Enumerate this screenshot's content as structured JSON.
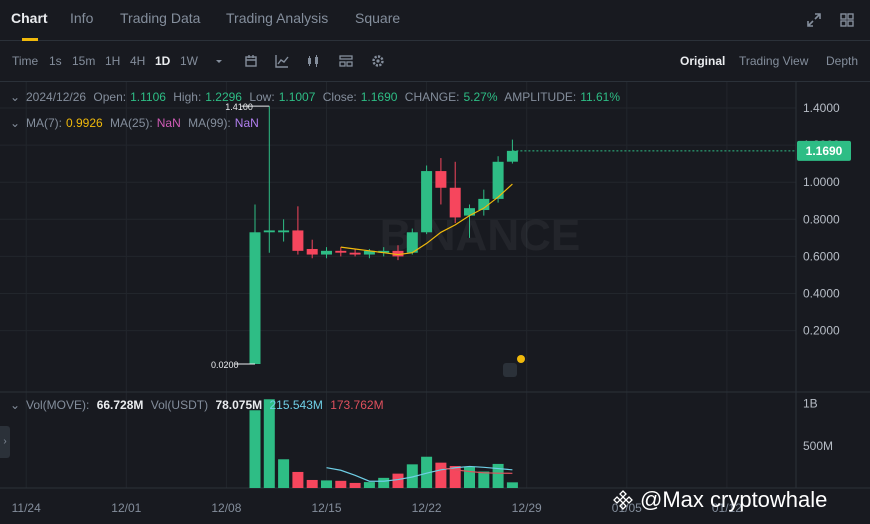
{
  "tabs": [
    "Chart",
    "Info",
    "Trading Data",
    "Trading Analysis",
    "Square"
  ],
  "window_icons": [
    "expand-icon",
    "grid-icon"
  ],
  "toolbar": {
    "time_label": "Time",
    "intervals": [
      "1s",
      "15m",
      "1H",
      "4H",
      "1D",
      "1W"
    ],
    "active_interval": "1D",
    "tool_icons": [
      "chevron-down-icon",
      "calendar-icon",
      "indicator-icon",
      "candle-type-icon",
      "template-icon",
      "gear-icon"
    ],
    "views": [
      "Original",
      "Trading View",
      "Depth"
    ],
    "active_view": "Original"
  },
  "ohlc": {
    "date": "2024/12/26",
    "open_label": "Open:",
    "open": "1.1106",
    "high_label": "High:",
    "high": "1.2296",
    "low_label": "Low:",
    "low": "1.1007",
    "close_label": "Close:",
    "close": "1.1690",
    "change_label": "CHANGE:",
    "change": "5.27%",
    "amplitude_label": "AMPLITUDE:",
    "amplitude": "11.61%"
  },
  "ma": {
    "ma7_label": "MA(7):",
    "ma7": "0.9926",
    "ma25_label": "MA(25):",
    "ma25": "NaN",
    "ma99_label": "MA(99):",
    "ma99": "NaN"
  },
  "volume": {
    "vol_label": "Vol(MOVE):",
    "vol": "66.728M",
    "usdt_label": "Vol(USDT)",
    "usdt": "78.075M",
    "ma1": "215.543M",
    "ma2": "173.762M"
  },
  "watermark": {
    "chart_logo": "BINANCE",
    "credit": "@Max cryptowhale"
  },
  "colors": {
    "up": "#2ebd85",
    "down": "#f6465d",
    "ma7": "#f0b90b",
    "vol_ma1": "#6fcfe6",
    "vol_ma2": "#e0505d",
    "accent": "#f0b90b"
  },
  "chart_data": {
    "type": "candlestick",
    "price_axis": {
      "ticks": [
        0.2,
        0.4,
        0.6,
        0.8,
        1.0,
        1.2,
        1.4
      ],
      "tick_labels": [
        "0.2000",
        "0.4000",
        "0.6000",
        "0.8000",
        "1.0000",
        "1.2000",
        "1.4000"
      ],
      "ylim": [
        0.02,
        1.5
      ]
    },
    "current_price_label": "1.1690",
    "max_marker": "1.4100",
    "min_marker": "0.0200",
    "x_ticks": [
      {
        "label": "11/24",
        "day": -16
      },
      {
        "label": "12/01",
        "day": -9
      },
      {
        "label": "12/08",
        "day": -2
      },
      {
        "label": "12/15",
        "day": 5
      },
      {
        "label": "12/22",
        "day": 12
      },
      {
        "label": "12/29",
        "day": 19
      },
      {
        "label": "01/05",
        "day": 26
      },
      {
        "label": "01/12",
        "day": 33
      }
    ],
    "candles": [
      {
        "o": 0.02,
        "h": 0.88,
        "l": 0.02,
        "c": 0.73
      },
      {
        "o": 0.73,
        "h": 1.41,
        "l": 0.62,
        "c": 0.74
      },
      {
        "o": 0.73,
        "h": 0.8,
        "l": 0.68,
        "c": 0.74
      },
      {
        "o": 0.74,
        "h": 0.87,
        "l": 0.61,
        "c": 0.63
      },
      {
        "o": 0.64,
        "h": 0.69,
        "l": 0.59,
        "c": 0.61
      },
      {
        "o": 0.61,
        "h": 0.65,
        "l": 0.59,
        "c": 0.63
      },
      {
        "o": 0.63,
        "h": 0.65,
        "l": 0.6,
        "c": 0.62
      },
      {
        "o": 0.62,
        "h": 0.64,
        "l": 0.6,
        "c": 0.61
      },
      {
        "o": 0.61,
        "h": 0.64,
        "l": 0.59,
        "c": 0.63
      },
      {
        "o": 0.62,
        "h": 0.65,
        "l": 0.6,
        "c": 0.63
      },
      {
        "o": 0.63,
        "h": 0.66,
        "l": 0.58,
        "c": 0.6
      },
      {
        "o": 0.62,
        "h": 0.75,
        "l": 0.61,
        "c": 0.73
      },
      {
        "o": 0.73,
        "h": 1.09,
        "l": 0.72,
        "c": 1.06
      },
      {
        "o": 1.06,
        "h": 1.13,
        "l": 0.88,
        "c": 0.97
      },
      {
        "o": 0.97,
        "h": 1.11,
        "l": 0.78,
        "c": 0.81
      },
      {
        "o": 0.82,
        "h": 0.88,
        "l": 0.7,
        "c": 0.86
      },
      {
        "o": 0.85,
        "h": 0.96,
        "l": 0.82,
        "c": 0.91
      },
      {
        "o": 0.91,
        "h": 1.14,
        "l": 0.89,
        "c": 1.11
      },
      {
        "o": 1.1106,
        "h": 1.2296,
        "l": 1.1007,
        "c": 1.169
      }
    ],
    "first_candle_day": 0,
    "ma7": [
      null,
      null,
      null,
      null,
      null,
      null,
      0.65,
      0.64,
      0.63,
      0.62,
      0.61,
      0.62,
      0.67,
      0.73,
      0.77,
      0.82,
      0.86,
      0.92,
      0.99
    ],
    "volume_axis": {
      "tick_labels": [
        "500M",
        "1B"
      ],
      "ticks": [
        500,
        1000
      ],
      "unit": "M"
    },
    "volumes": [
      920,
      1050,
      340,
      190,
      95,
      90,
      85,
      60,
      70,
      120,
      170,
      280,
      370,
      300,
      260,
      250,
      195,
      285,
      67
    ],
    "vol_ma1": [
      null,
      null,
      null,
      null,
      null,
      240,
      210,
      150,
      80,
      80,
      100,
      130,
      175,
      215,
      240,
      255,
      245,
      230,
      215
    ],
    "vol_ma2": [
      null,
      null,
      null,
      null,
      null,
      null,
      null,
      null,
      null,
      null,
      null,
      null,
      null,
      240,
      215,
      195,
      180,
      175,
      174
    ]
  }
}
